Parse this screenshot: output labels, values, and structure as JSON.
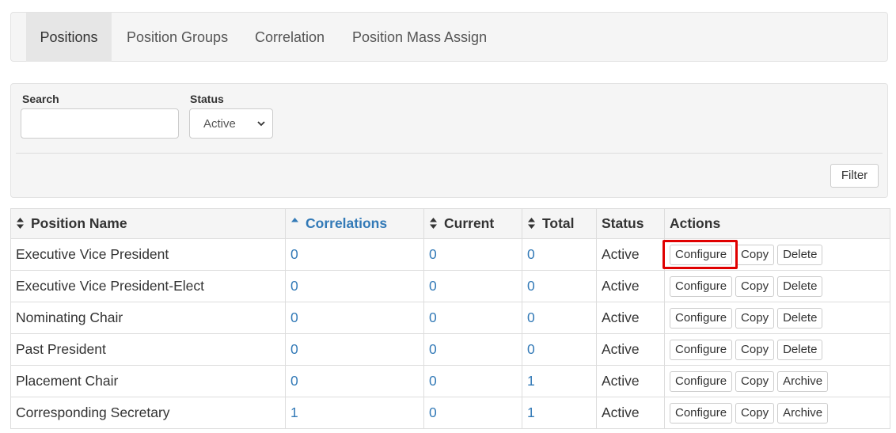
{
  "tabs": [
    {
      "label": "Positions",
      "active": true
    },
    {
      "label": "Position Groups",
      "active": false
    },
    {
      "label": "Correlation",
      "active": false
    },
    {
      "label": "Position Mass Assign",
      "active": false
    }
  ],
  "filters": {
    "search_label": "Search",
    "search_value": "",
    "status_label": "Status",
    "status_value": "Active",
    "filter_button": "Filter"
  },
  "table": {
    "columns": [
      {
        "label": "Position Name",
        "sort": "both"
      },
      {
        "label": "Correlations",
        "sort": "asc"
      },
      {
        "label": "Current",
        "sort": "both"
      },
      {
        "label": "Total",
        "sort": "both"
      },
      {
        "label": "Status",
        "sort": "none"
      },
      {
        "label": "Actions",
        "sort": "none"
      }
    ],
    "rows": [
      {
        "name": "Executive Vice President",
        "correlations": "0",
        "current": "0",
        "total": "0",
        "status": "Active",
        "actions": [
          "Configure",
          "Copy",
          "Delete"
        ]
      },
      {
        "name": "Executive Vice President-Elect",
        "correlations": "0",
        "current": "0",
        "total": "0",
        "status": "Active",
        "actions": [
          "Configure",
          "Copy",
          "Delete"
        ]
      },
      {
        "name": "Nominating Chair",
        "correlations": "0",
        "current": "0",
        "total": "0",
        "status": "Active",
        "actions": [
          "Configure",
          "Copy",
          "Delete"
        ]
      },
      {
        "name": "Past President",
        "correlations": "0",
        "current": "0",
        "total": "0",
        "status": "Active",
        "actions": [
          "Configure",
          "Copy",
          "Delete"
        ]
      },
      {
        "name": "Placement Chair",
        "correlations": "0",
        "current": "0",
        "total": "1",
        "status": "Active",
        "actions": [
          "Configure",
          "Copy",
          "Archive"
        ]
      },
      {
        "name": "Corresponding Secretary",
        "correlations": "1",
        "current": "0",
        "total": "1",
        "status": "Active",
        "actions": [
          "Configure",
          "Copy",
          "Archive"
        ]
      }
    ]
  },
  "colors": {
    "link": "#337ab7",
    "highlight": "#e00000"
  }
}
